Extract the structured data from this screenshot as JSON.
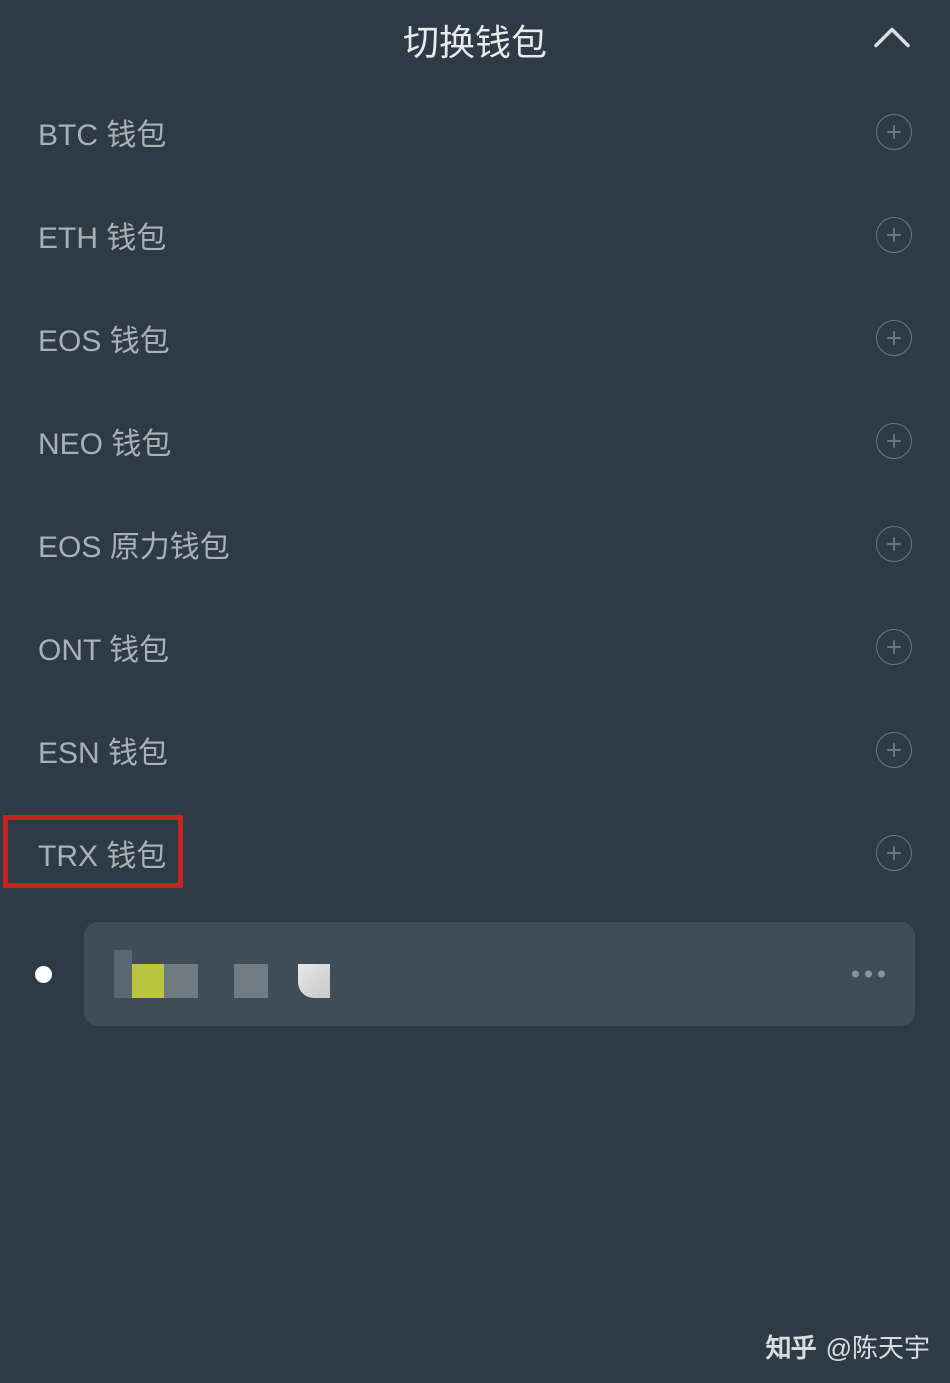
{
  "header": {
    "title": "切换钱包"
  },
  "wallets": [
    {
      "label": "BTC 钱包"
    },
    {
      "label": "ETH 钱包"
    },
    {
      "label": "EOS 钱包"
    },
    {
      "label": "NEO 钱包"
    },
    {
      "label": "EOS 原力钱包"
    },
    {
      "label": "ONT 钱包"
    },
    {
      "label": "ESN 钱包"
    },
    {
      "label": "TRX 钱包"
    }
  ],
  "watermark": {
    "logo": "知乎",
    "author": "@陈天宇"
  }
}
